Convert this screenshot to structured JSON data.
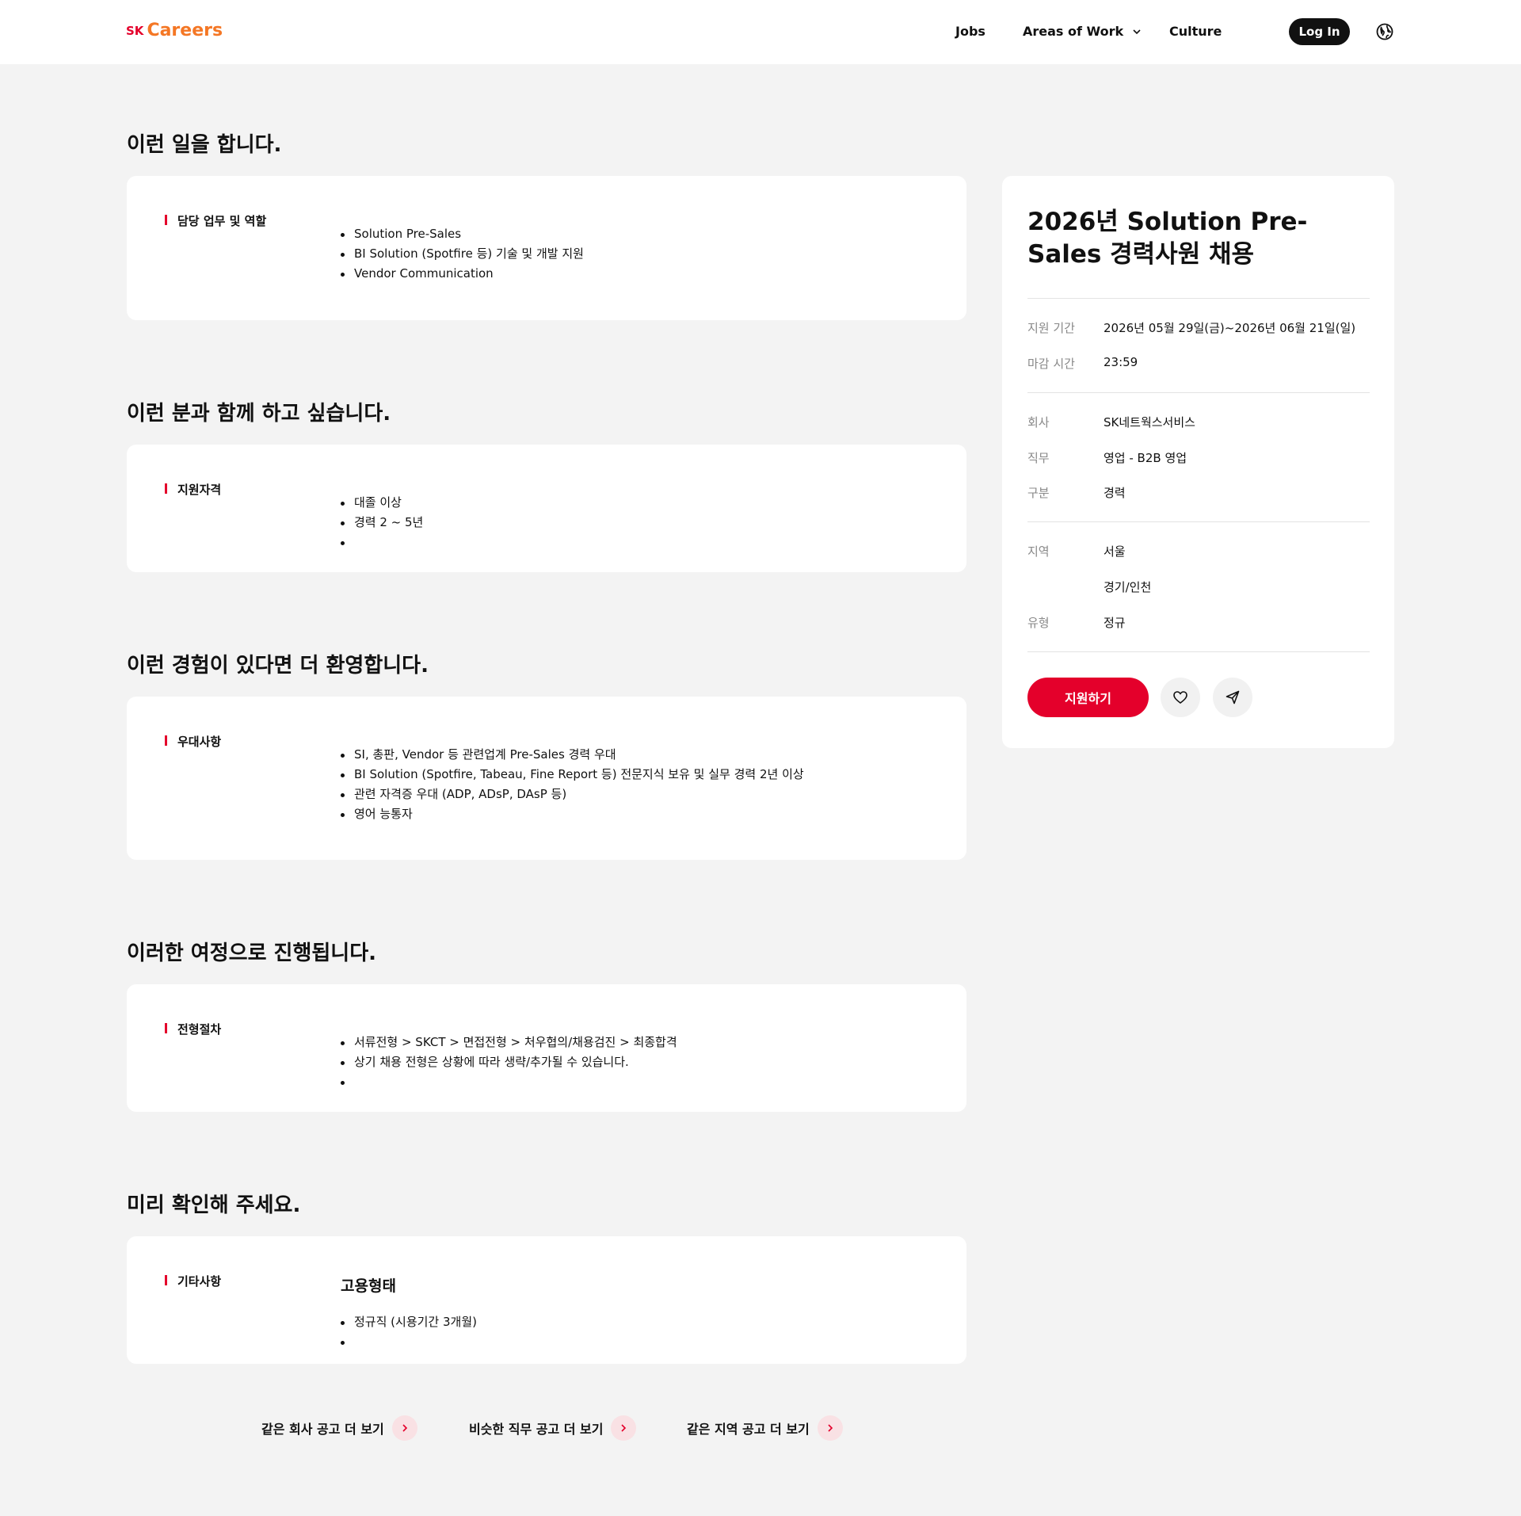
{
  "header": {
    "logo_sk": "SK",
    "logo_careers": "Careers",
    "nav": {
      "jobs": "Jobs",
      "areas": "Areas of Work",
      "culture": "Culture"
    },
    "login": "Log In"
  },
  "sections": [
    {
      "title": "이런 일을 합니다.",
      "label": "담당 업무 및 역할",
      "items": [
        "Solution Pre-Sales",
        "BI Solution (Spotfire 등) 기술 및 개발 지원",
        "Vendor Communication"
      ]
    },
    {
      "title": "이런 분과 함께 하고 싶습니다.",
      "label": "지원자격",
      "items": [
        "대졸 이상",
        "경력 2 ~ 5년",
        ""
      ]
    },
    {
      "title": "이런 경험이 있다면 더 환영합니다.",
      "label": "우대사항",
      "items": [
        "SI, 총판, Vendor 등 관련업계 Pre-Sales 경력 우대",
        "BI Solution (Spotfire, Tabeau, Fine Report 등) 전문지식 보유 및 실무 경력 2년 이상",
        "관련 자격증 우대 (ADP, ADsP, DAsP 등)",
        "영어 능통자"
      ]
    },
    {
      "title": "이러한 여정으로 진행됩니다.",
      "label": "전형절차",
      "items": [
        "서류전형 > SKCT > 면접전형 > 처우협의/채용검진 > 최종합격",
        "상기 채용 전형은 상황에 따라 생략/추가될 수 있습니다.",
        ""
      ]
    },
    {
      "title": "미리 확인해 주세요.",
      "label": "기타사항",
      "subheading": "고용형태",
      "items": [
        "정규직 (시용기간 3개월)",
        ""
      ]
    }
  ],
  "more_links": [
    "같은 회사 공고 더 보기",
    "비슷한 직무 공고 더 보기",
    "같은 지역 공고 더 보기"
  ],
  "job": {
    "title": "2026년 Solution Pre-Sales 경력사원 채용",
    "period_label": "지원 기간",
    "period": "2026년 05월 29일(금)~2026년 06월 21일(일)",
    "deadline_label": "마감 시간",
    "deadline": "23:59",
    "company_label": "회사",
    "company": "SK네트웍스서비스",
    "role_label": "직무",
    "role": "영업 - B2B 영업",
    "type_label": "구분",
    "type": "경력",
    "region_label": "지역",
    "region1": "서울",
    "region2": "경기/인천",
    "emp_label": "유형",
    "emp": "정규",
    "apply": "지원하기"
  },
  "colors": {
    "accent": "#e4002b",
    "logo_orange": "#f47725",
    "background": "#f3f3f3"
  }
}
